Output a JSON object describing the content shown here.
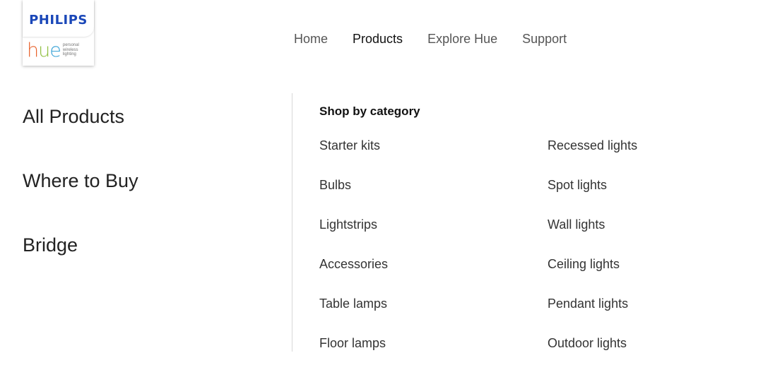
{
  "logo": {
    "brand": "PHILIPS",
    "hue_h": "h",
    "hue_u": "u",
    "hue_e": "e",
    "tagline": [
      "personal",
      "wireless",
      "lighting"
    ]
  },
  "nav": {
    "items": [
      {
        "label": "Home"
      },
      {
        "label": "Products"
      },
      {
        "label": "Explore Hue"
      },
      {
        "label": "Support"
      }
    ]
  },
  "left_menu": {
    "items": [
      {
        "label": "All Products"
      },
      {
        "label": "Where to Buy"
      },
      {
        "label": "Bridge"
      }
    ]
  },
  "categories": {
    "heading": "Shop by category",
    "column1": [
      {
        "label": "Starter kits"
      },
      {
        "label": "Bulbs"
      },
      {
        "label": "Lightstrips"
      },
      {
        "label": "Accessories"
      },
      {
        "label": "Table lamps"
      },
      {
        "label": "Floor lamps"
      }
    ],
    "column2": [
      {
        "label": "Recessed lights"
      },
      {
        "label": "Spot lights"
      },
      {
        "label": "Wall lights"
      },
      {
        "label": "Ceiling lights"
      },
      {
        "label": "Pendant lights"
      },
      {
        "label": "Outdoor lights"
      }
    ]
  },
  "colors": {
    "philips_blue": "#1a47b8",
    "hue_orange": "#e8622c",
    "hue_green": "#8fbf3f",
    "hue_blue": "#3aa3d6"
  }
}
